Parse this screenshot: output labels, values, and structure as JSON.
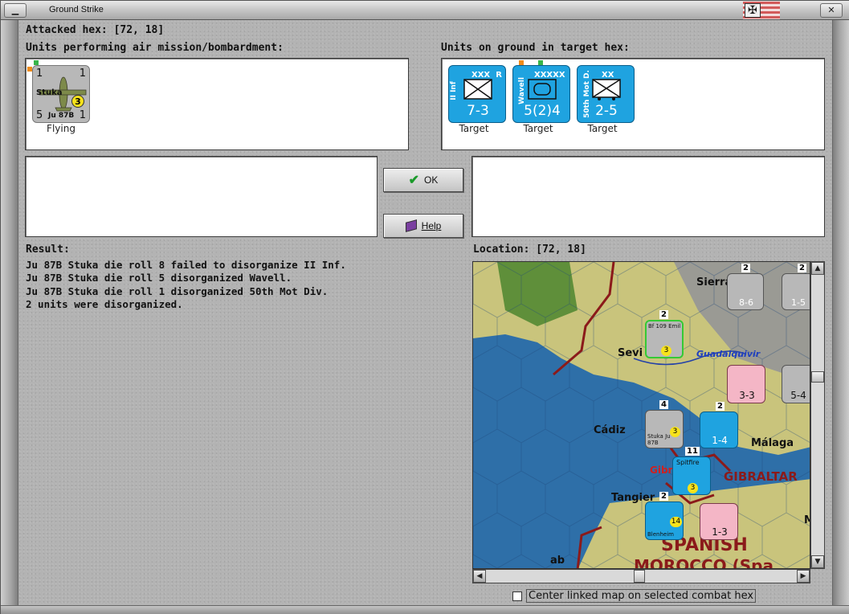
{
  "window": {
    "title": "Ground Strike",
    "minimize_glyph": "▁",
    "close_glyph": "✕",
    "flag_glyph": "✠"
  },
  "attacked_hex": {
    "label": "Attacked hex:",
    "value": "[72, 18]"
  },
  "attackers_panel": {
    "label": "Units performing air mission/bombardment:",
    "units": [
      {
        "name": "Stuka",
        "model": "Ju 87B",
        "top_left": "1",
        "top_right": "1",
        "bottom_left": "5",
        "bottom_right": "1",
        "badge": "3",
        "status": "Flying"
      }
    ]
  },
  "targets_panel": {
    "label": "Units on ground in target hex:",
    "units": [
      {
        "name": "II Inf",
        "size": "XXX",
        "corner": "R",
        "value": "7-3",
        "status": "Target",
        "color": "#1fa3e0"
      },
      {
        "name": "Wavell",
        "size": "XXXXX",
        "corner": "",
        "value": "5(2)4",
        "status": "Target",
        "color": "#1fa3e0"
      },
      {
        "name": "50th Mot D.",
        "size": "XX",
        "corner": "",
        "value": "2-5",
        "status": "Target",
        "color": "#1fa3e0"
      }
    ]
  },
  "buttons": {
    "ok": "OK",
    "help": "Help"
  },
  "result": {
    "label": "Result:",
    "lines": [
      "Ju 87B Stuka die roll 8 failed to disorganize II Inf.",
      "Ju 87B Stuka die roll 5 disorganized Wavell.",
      "Ju 87B Stuka die roll 1 disorganized 50th Mot Div.",
      "2 units were disorganized."
    ]
  },
  "location": {
    "label": "Location:",
    "value": "[72, 18]"
  },
  "map": {
    "places": [
      "Sierra",
      "Sevi",
      "Guadalquivir",
      "Cádiz",
      "Málaga",
      "Gibr",
      "GIBRALTAR",
      "Tangier",
      "SPANISH",
      "MOROCCO (Spa",
      "M",
      "ab"
    ],
    "counters": [
      {
        "label": "8-6",
        "stack": "2"
      },
      {
        "label": "1-5",
        "stack": "2"
      },
      {
        "label": "Bf 109 Emil",
        "stack": "2",
        "badge": "3"
      },
      {
        "label": "3-3",
        "stack": ""
      },
      {
        "label": "5-4",
        "stack": ""
      },
      {
        "label": "Stuka Ju 87B",
        "stack": "4",
        "badge": "3"
      },
      {
        "label": "1-4",
        "stack": "2"
      },
      {
        "label": "Spitfire",
        "stack": "11",
        "badge": "3"
      },
      {
        "label": "Blenheim",
        "stack": "2",
        "badge": "14"
      },
      {
        "label": "1-3",
        "stack": ""
      }
    ]
  },
  "checkbox": {
    "label": "Center linked map on selected combat hex",
    "checked": false
  },
  "colors": {
    "allied_counter": "#1fa3e0",
    "axis_counter": "#b8b8b8",
    "spanish_counter": "#f4b6c6",
    "sea": "#2e6fa8",
    "land": "#c9c47c",
    "border": "#8b1a1a"
  }
}
